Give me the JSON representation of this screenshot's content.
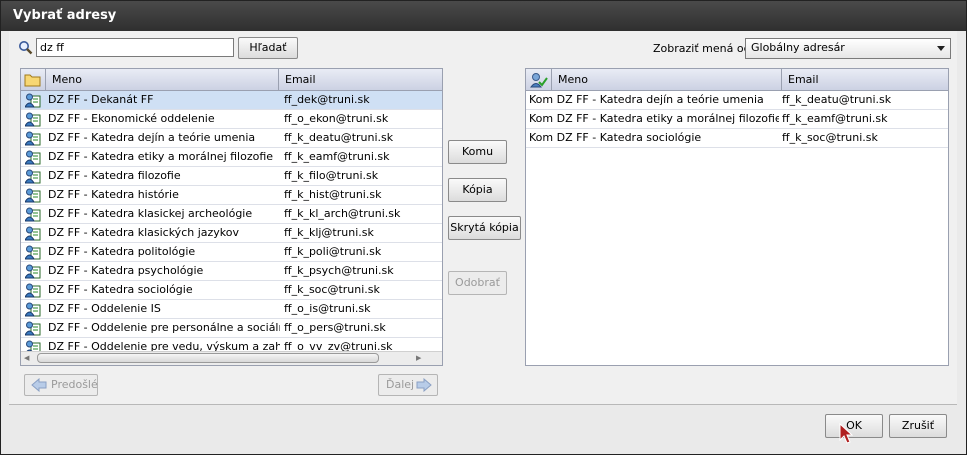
{
  "window": {
    "title": "Vybrať adresy"
  },
  "search": {
    "value": "dz ff",
    "button_label": "Hľadať"
  },
  "address_book": {
    "label": "Zobraziť mená od:",
    "selected": "Globálny adresár"
  },
  "left_table": {
    "columns": [
      "Meno",
      "Email"
    ],
    "rows": [
      {
        "name": "DZ FF - Dekanát FF",
        "email": "ff_dek@truni.sk"
      },
      {
        "name": "DZ FF - Ekonomické oddelenie",
        "email": "ff_o_ekon@truni.sk"
      },
      {
        "name": "DZ FF - Katedra dejín a teórie umenia",
        "email": "ff_k_deatu@truni.sk"
      },
      {
        "name": "DZ FF - Katedra etiky a morálnej filozofie",
        "email": "ff_k_eamf@truni.sk"
      },
      {
        "name": "DZ FF - Katedra filozofie",
        "email": "ff_k_filo@truni.sk"
      },
      {
        "name": "DZ FF - Katedra histórie",
        "email": "ff_k_hist@truni.sk"
      },
      {
        "name": "DZ FF - Katedra klasickej archeológie",
        "email": "ff_k_kl_arch@truni.sk"
      },
      {
        "name": "DZ FF - Katedra klasických jazykov",
        "email": "ff_k_klj@truni.sk"
      },
      {
        "name": "DZ FF - Katedra politológie",
        "email": "ff_k_poli@truni.sk"
      },
      {
        "name": "DZ FF - Katedra psychológie",
        "email": "ff_k_psych@truni.sk"
      },
      {
        "name": "DZ FF - Katedra sociológie",
        "email": "ff_k_soc@truni.sk"
      },
      {
        "name": "DZ FF - Oddelenie IS",
        "email": "ff_o_is@truni.sk"
      },
      {
        "name": "DZ FF - Oddelenie pre personálne a sociálne ot",
        "email": "ff_o_pers@truni.sk"
      },
      {
        "name": "DZ FF - Oddelenie pre vedu, výskum a zahraničné",
        "email": "ff_o_vv_zv@truni.sk"
      }
    ]
  },
  "middle": {
    "to": "Komu",
    "cc": "Kópia",
    "bcc": "Skrytá kópia",
    "remove": "Odobrať"
  },
  "pager": {
    "prev": "Predošlé",
    "next": "Ďalej"
  },
  "right_table": {
    "columns": [
      "Meno",
      "Email"
    ],
    "rows": [
      {
        "name": "Kom DZ FF - Katedra dejín a teórie umenia",
        "email": "ff_k_deatu@truni.sk"
      },
      {
        "name": "Kom DZ FF - Katedra etiky a morálnej filozofie",
        "email": "ff_k_eamf@truni.sk"
      },
      {
        "name": "Kom DZ FF - Katedra sociológie",
        "email": "ff_k_soc@truni.sk"
      }
    ]
  },
  "footer": {
    "ok": "OK",
    "cancel": "Zrušiť"
  },
  "colors": {
    "accent": "#cfe0f4",
    "header": "#ccd1e3",
    "titlebar": "#333333"
  }
}
